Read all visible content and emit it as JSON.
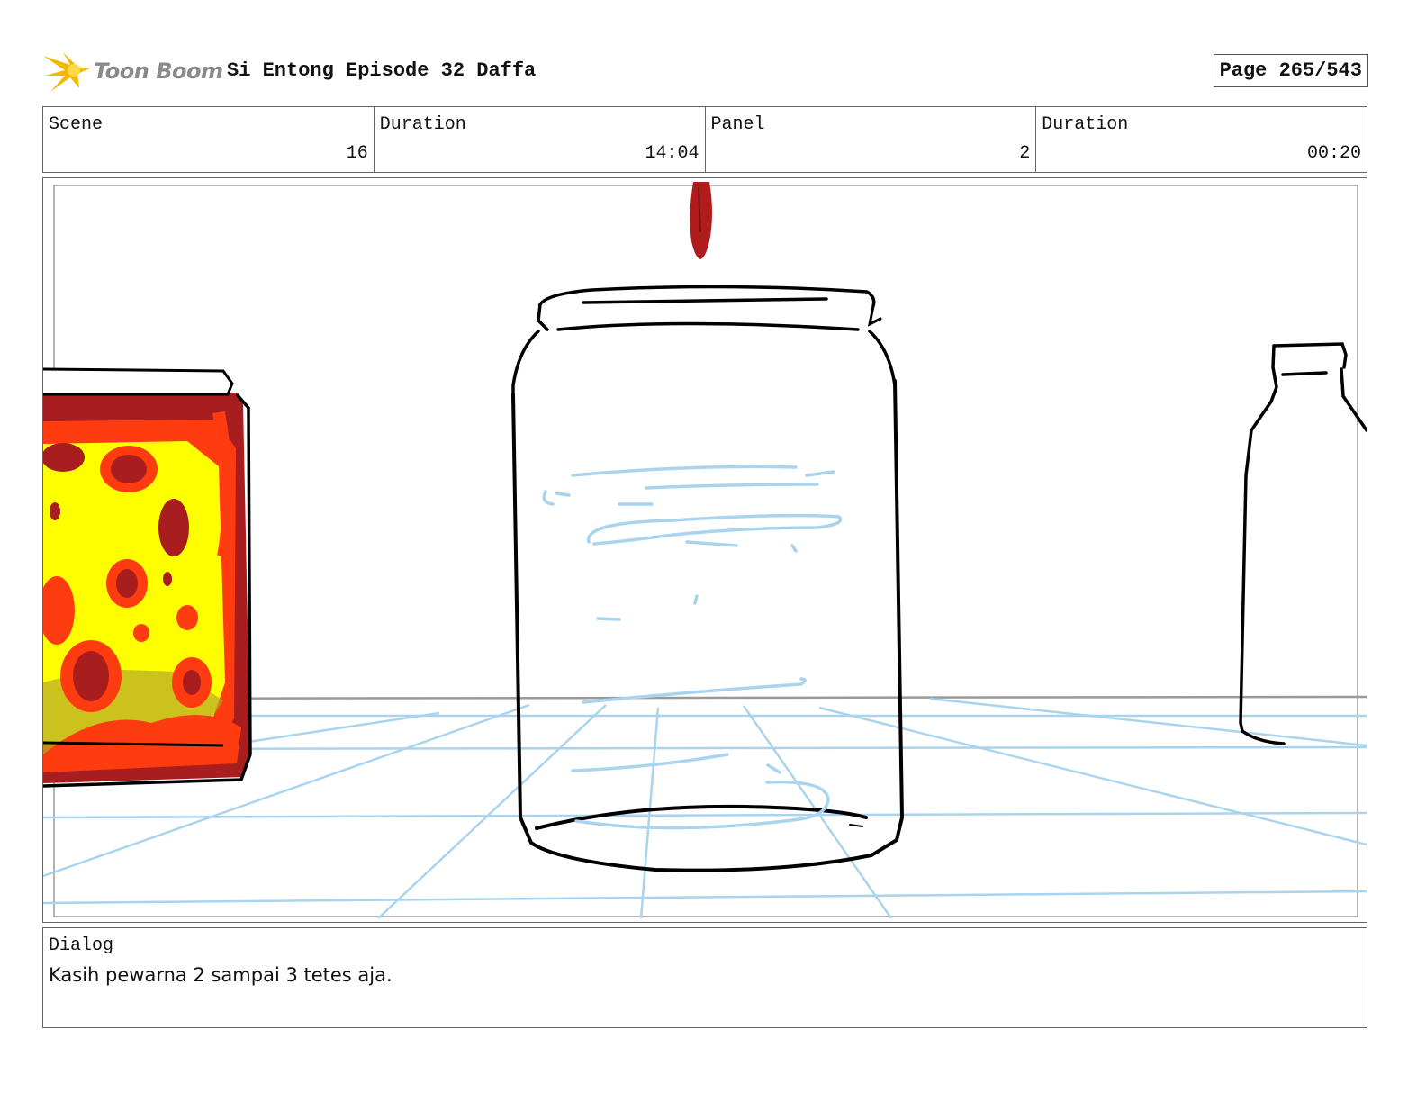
{
  "header": {
    "logo_text": "Toon Boom",
    "title": "Si Entong Episode 32 Daffa",
    "page": "Page 265/543"
  },
  "info": {
    "scene_label": "Scene",
    "scene_value": "16",
    "duration_label": "Duration",
    "duration_value": "14:04",
    "panel_label": "Panel",
    "panel_value": "2",
    "panel_duration_label": "Duration",
    "panel_duration_value": "00:20"
  },
  "dialog": {
    "label": "Dialog",
    "text": "Kasih pewarna 2 sampai 3 tetes aja."
  },
  "colors": {
    "sketch_line": "#000000",
    "water_blue": "#a9d4ee",
    "drop_red": "#b01c1c",
    "jar_red": "#a81d1d",
    "jar_orange": "#ff3c10",
    "jar_yellow": "#ffff00",
    "logo_star": "#f5b800"
  }
}
